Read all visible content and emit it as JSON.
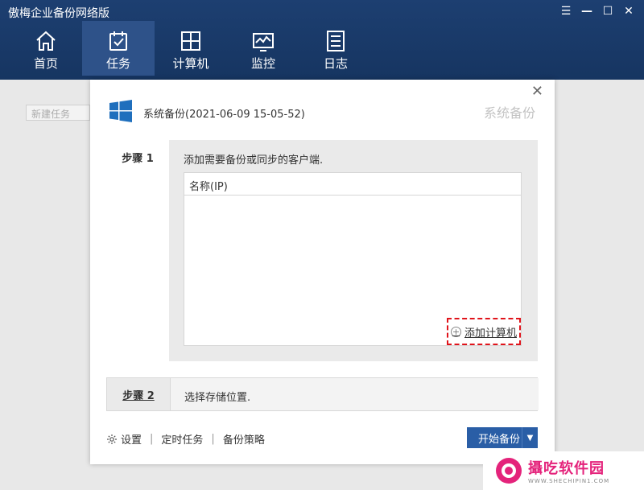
{
  "app": {
    "title": "傲梅企业备份网络版",
    "window_controls": [
      "menu-icon",
      "minimize-icon",
      "maximize-icon",
      "close-icon"
    ]
  },
  "nav": [
    {
      "label": "首页",
      "icon": "home-icon"
    },
    {
      "label": "任务",
      "icon": "task-icon",
      "active": true
    },
    {
      "label": "计算机",
      "icon": "computer-icon"
    },
    {
      "label": "监控",
      "icon": "monitor-icon"
    },
    {
      "label": "日志",
      "icon": "log-icon"
    }
  ],
  "background": {
    "new_task_placeholder": "新建任务"
  },
  "dialog": {
    "subtitle": "系统备份(2021-06-09 15-05-52)",
    "type_label": "系统备份",
    "step1": {
      "tab": "步骤 1",
      "description": "添加需要备份或同步的客户端.",
      "list_header": "名称(IP)",
      "add_computer": "添加计算机"
    },
    "step2": {
      "tab": "步骤 2",
      "description": "选择存储位置."
    },
    "footer": {
      "settings": "设置",
      "schedule": "定时任务",
      "strategy": "备份策略",
      "start_button": "开始备份"
    }
  },
  "watermark": {
    "brand": "攝吃软件园",
    "url": "WWW.SHECHIPIN1.COM"
  },
  "colors": {
    "topbar": "#1d3f71",
    "active_nav": "#2e5289",
    "primary_button": "#2a5ea6",
    "highlight_dashed": "#e0141b",
    "windows_blue": "#1f6fbd"
  }
}
